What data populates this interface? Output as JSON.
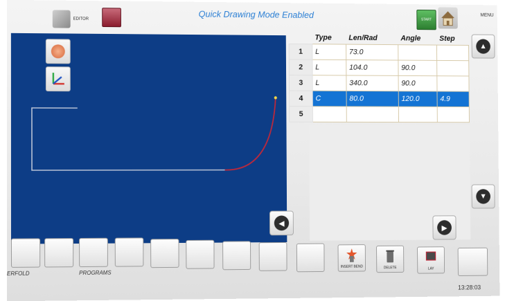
{
  "header": {
    "editor_label": "EDITOR",
    "mode_title": "Quick Drawing Mode Enabled",
    "start_label": "START",
    "menu_label": "MENU"
  },
  "table": {
    "columns": [
      "",
      "Type",
      "Len/Rad",
      "Angle",
      "Step"
    ],
    "rows": [
      {
        "num": "1",
        "type": "L",
        "len": "73.0",
        "angle": "",
        "step": ""
      },
      {
        "num": "2",
        "type": "L",
        "len": "104.0",
        "angle": "90.0",
        "step": ""
      },
      {
        "num": "3",
        "type": "L",
        "len": "340.0",
        "angle": "90.0",
        "step": ""
      },
      {
        "num": "4",
        "type": "C",
        "len": "80.0",
        "angle": "120.0",
        "step": "4.9"
      },
      {
        "num": "5",
        "type": "",
        "len": "",
        "angle": "",
        "step": ""
      }
    ],
    "selected_row": 4
  },
  "footer": {
    "left_label": "ERFOLD",
    "programs_label": "PROGRAMS",
    "insert_bend_label": "INSERT BEND",
    "delete_label": "DELETE",
    "extra_label": "LAY",
    "clock": "13:28:03"
  },
  "colors": {
    "canvas": "#0d3d86",
    "selected_row": "#1474d4",
    "title": "#2b7fd4",
    "start": "#2d7f31",
    "red_button": "#8b1c2e",
    "arc": "#c0283a"
  }
}
